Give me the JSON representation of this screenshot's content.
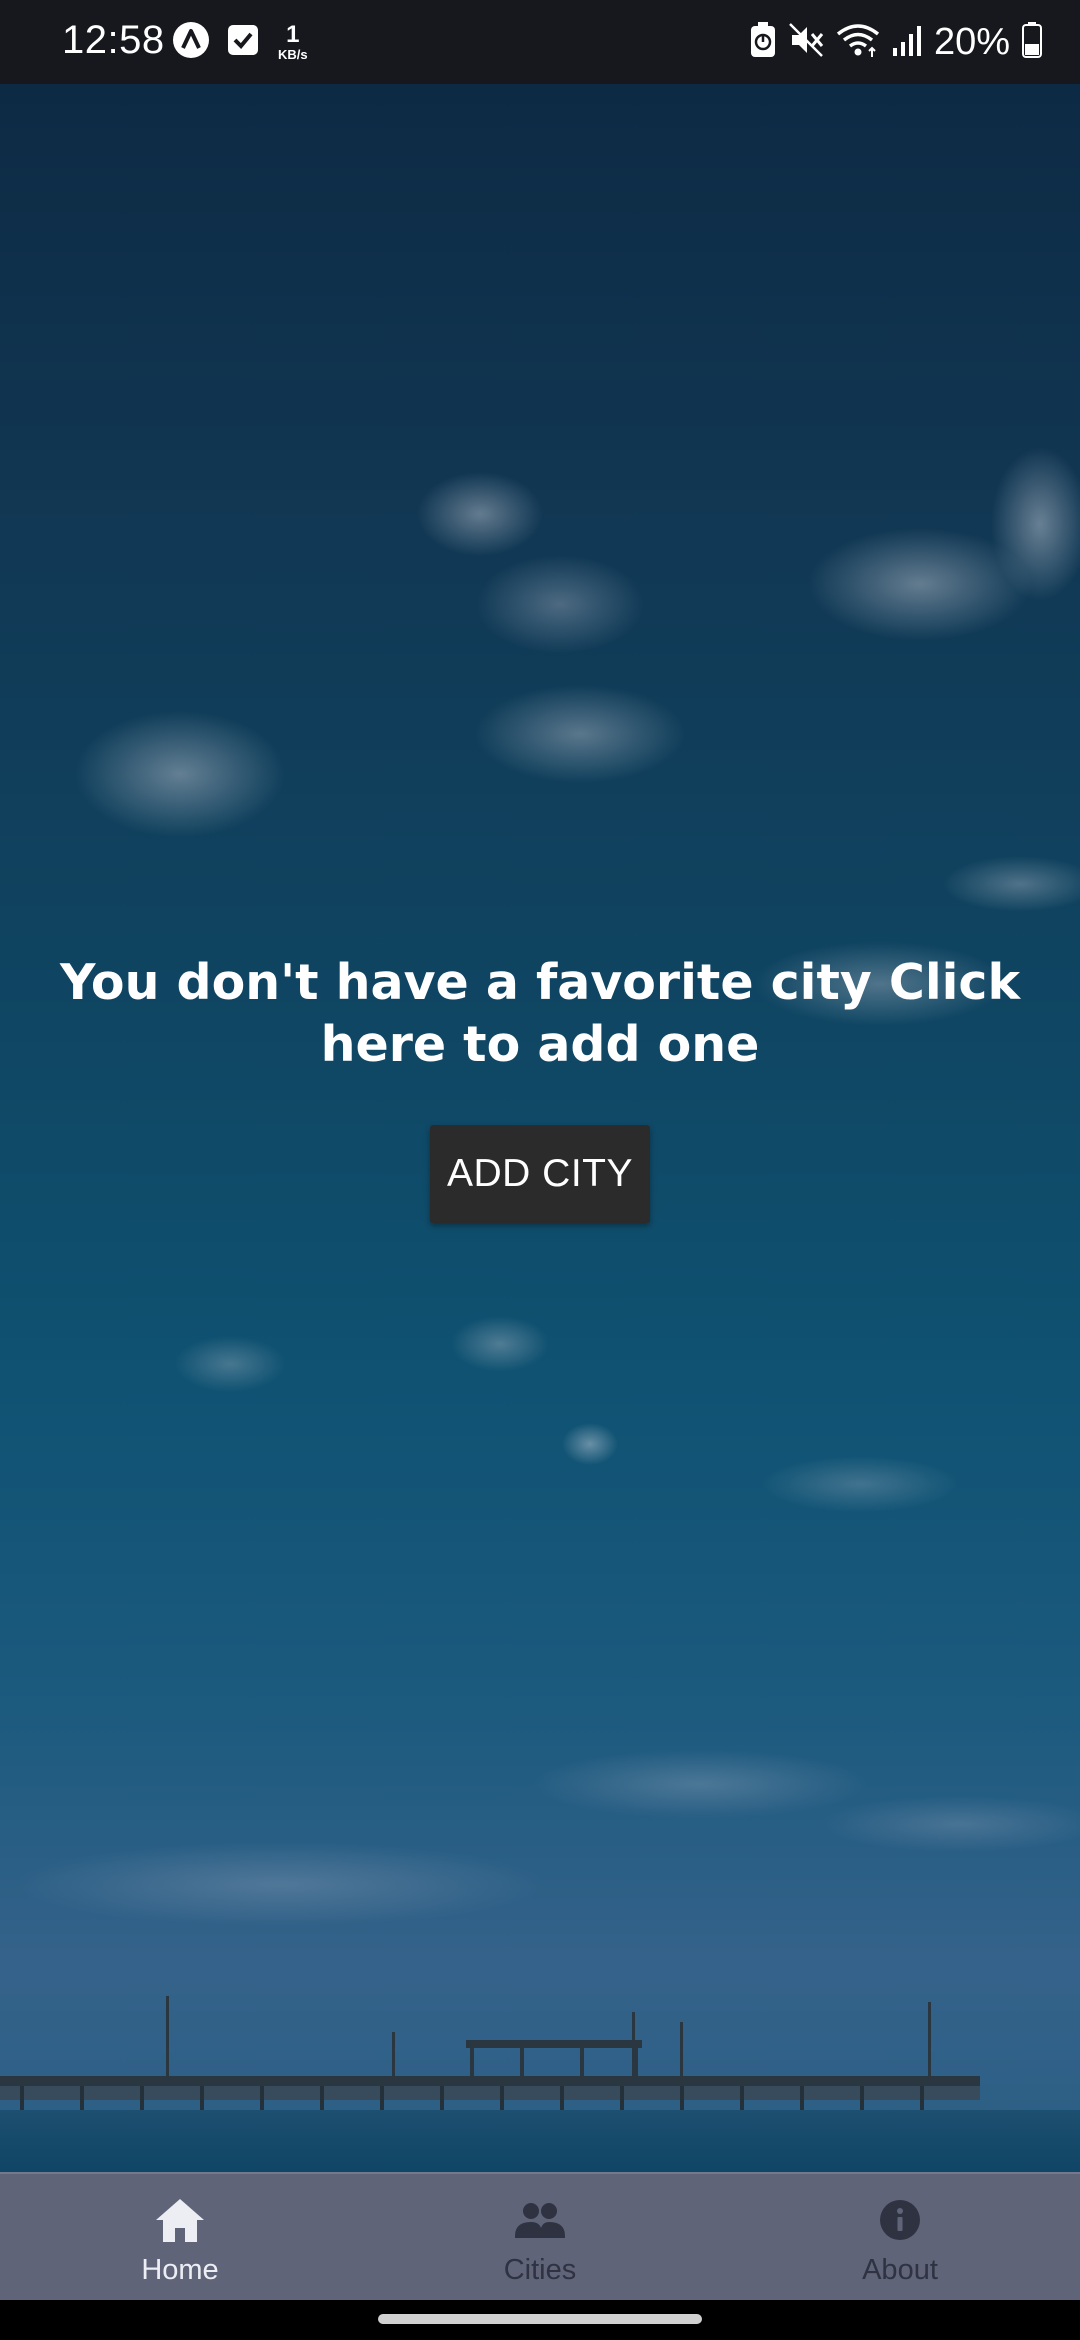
{
  "status_bar": {
    "time": "12:58",
    "net_speed_value": "1",
    "net_speed_unit": "KB/s",
    "battery": "20%"
  },
  "main": {
    "empty_message": "You don't have a favorite city Click here to add one",
    "add_city_label": "ADD CITY"
  },
  "tabs": [
    {
      "label": "Home",
      "icon": "home-icon",
      "active": true
    },
    {
      "label": "Cities",
      "icon": "people-icon",
      "active": false
    },
    {
      "label": "About",
      "icon": "info-icon",
      "active": false
    }
  ],
  "colors": {
    "tab_bar": "#5f6479",
    "active_tab": "#eceef4",
    "inactive_tab": "#2f3240",
    "button": "#2b2b2b",
    "status_bar": "#16181d"
  }
}
